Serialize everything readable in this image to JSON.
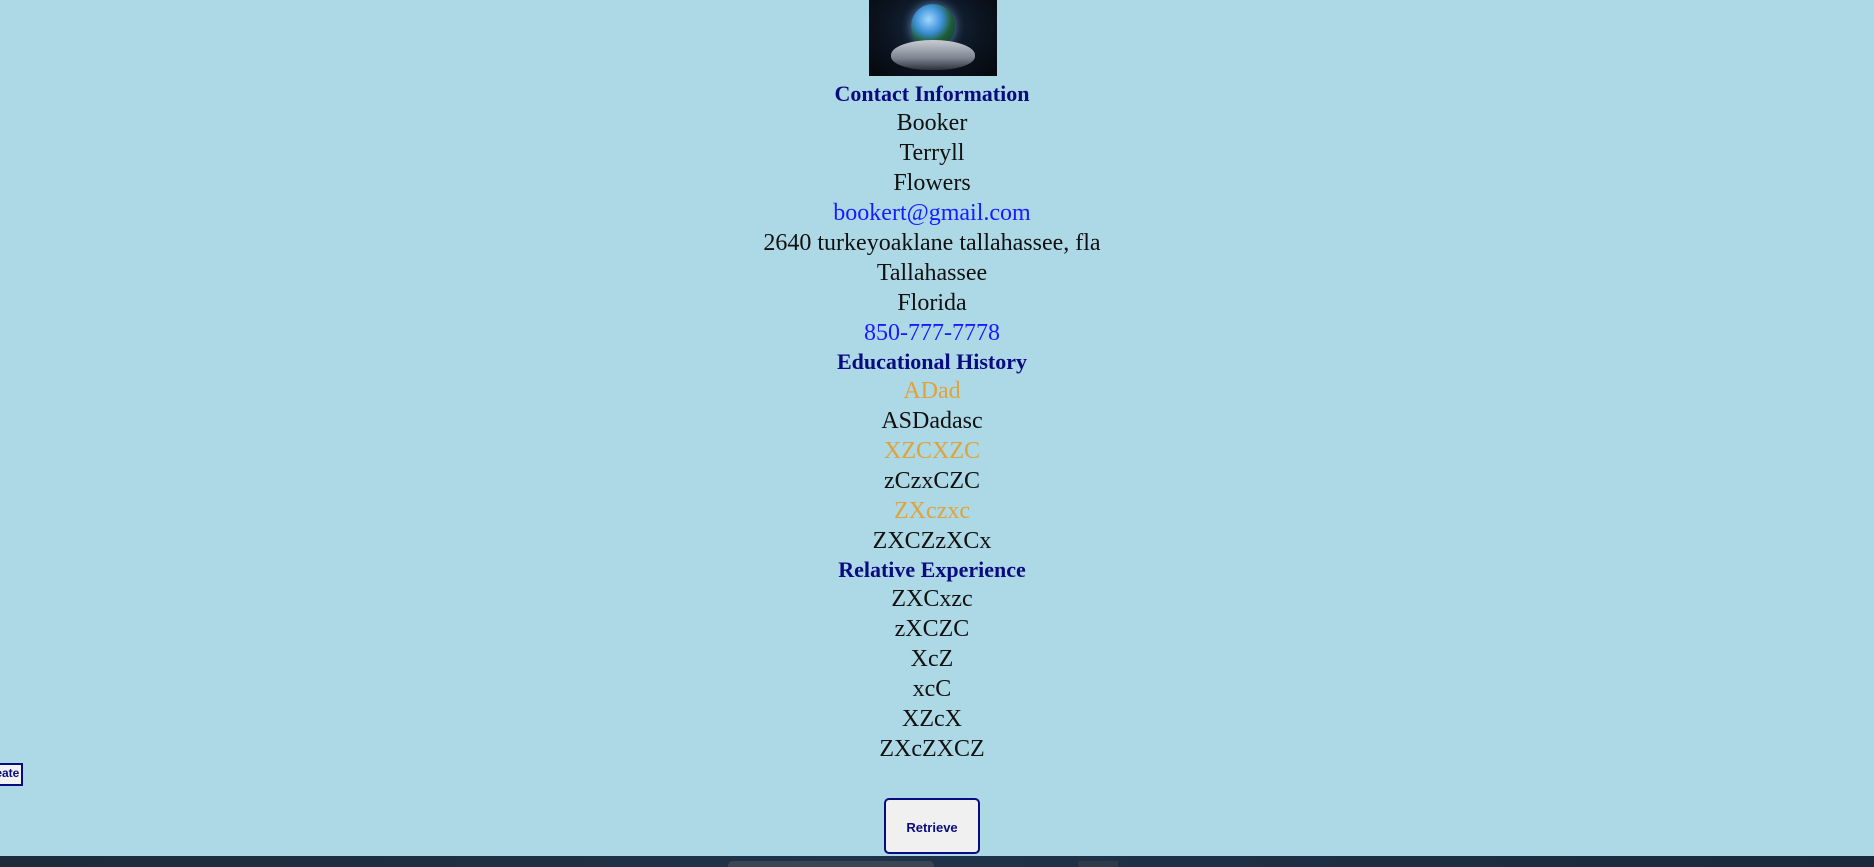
{
  "contact": {
    "heading": "Contact Information",
    "first_name": "Booker",
    "middle_name": "Terryll",
    "last_name": "Flowers",
    "email": "bookert@gmail.com",
    "address": "2640 turkeyoaklane tallahassee, fla",
    "city": "Tallahassee",
    "state": "Florida",
    "phone": "850-777-7778"
  },
  "education": {
    "heading": "Educational History",
    "entries": [
      {
        "school": "ADad",
        "detail": "ASDadasc"
      },
      {
        "school": "XZCXZC",
        "detail": "zCzxCZC"
      },
      {
        "school": "ZXczxc",
        "detail": "ZXCZzXCx"
      }
    ]
  },
  "experience": {
    "heading": "Relative Experience",
    "items": [
      "ZXCxzc",
      "zXCZC",
      "XcZ",
      "xcC",
      "XZcX",
      "ZXcZXCZ"
    ]
  },
  "buttons": {
    "create_label": "Create",
    "retrieve_label": "Retrieve"
  },
  "colors": {
    "background": "#add8e6",
    "heading": "#0b0b80",
    "link": "#1a1aff",
    "school": "#e0a33a"
  },
  "icons": {
    "logo": "globe-in-hands-icon"
  }
}
